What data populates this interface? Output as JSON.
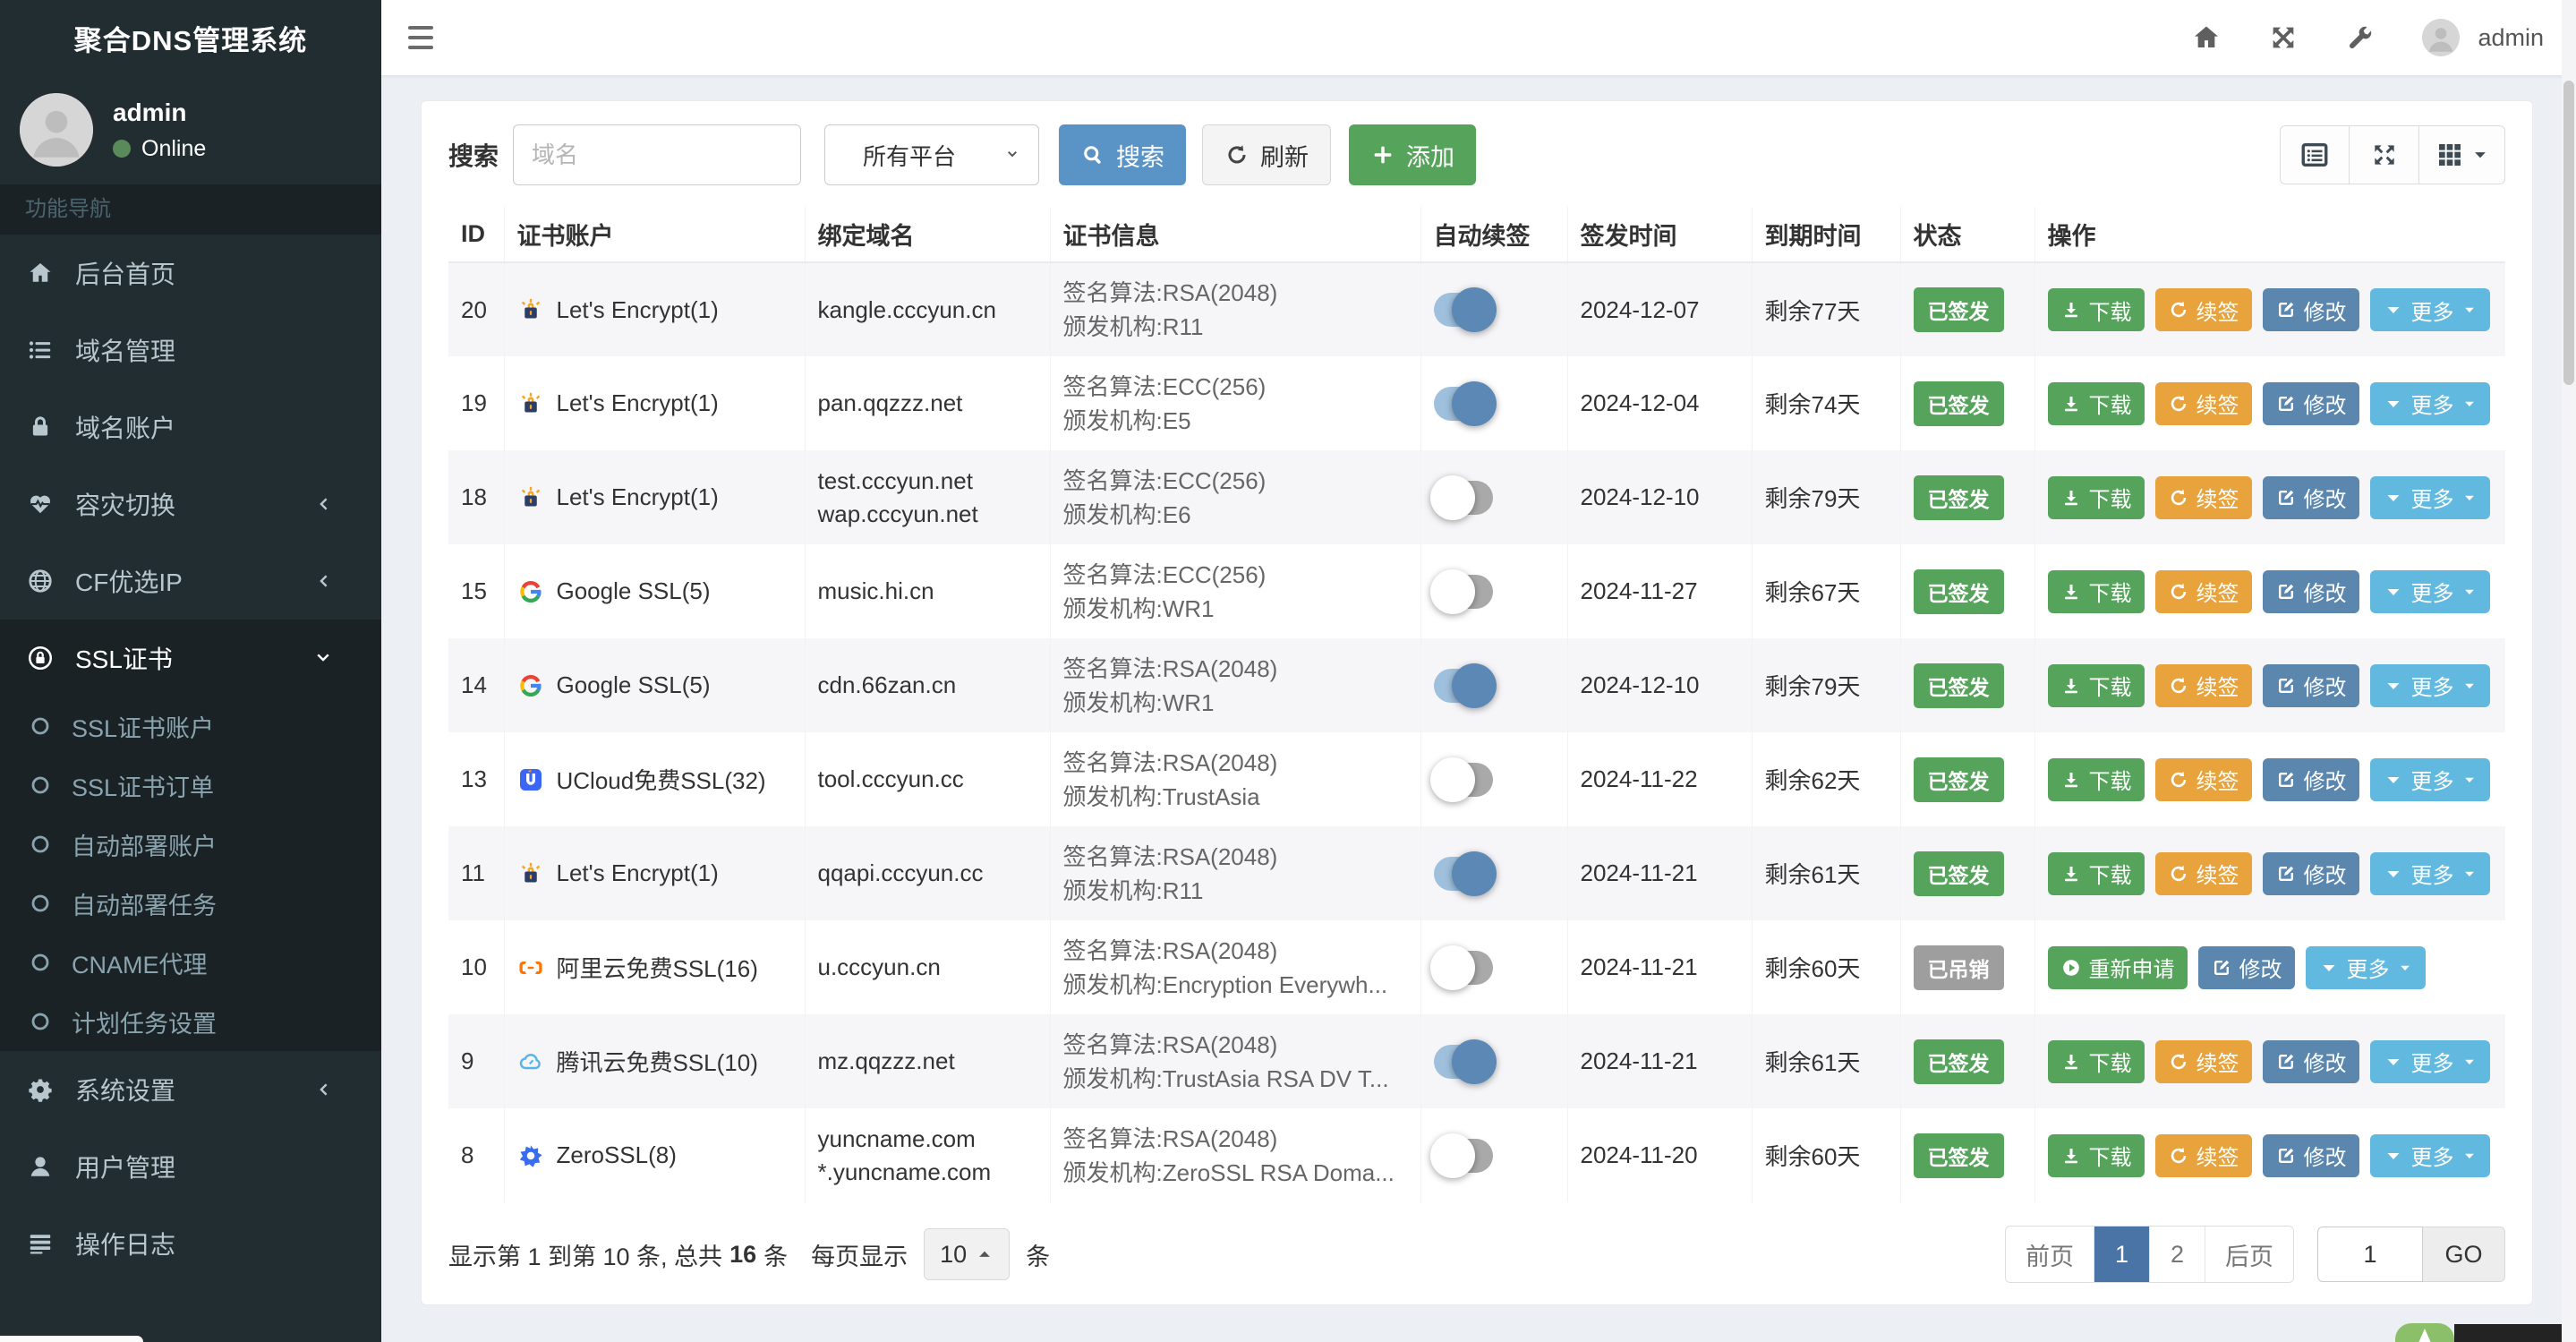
{
  "app": {
    "title": "聚合DNS管理系统"
  },
  "topbar": {
    "username": "admin",
    "icons": [
      "home-icon",
      "fullscreen-icon",
      "wrench-icon"
    ]
  },
  "sidebar": {
    "user": {
      "name": "admin",
      "status": "Online"
    },
    "nav_header": "功能导航",
    "items": [
      {
        "label": "后台首页",
        "icon": "home"
      },
      {
        "label": "域名管理",
        "icon": "list"
      },
      {
        "label": "域名账户",
        "icon": "lock"
      },
      {
        "label": "容灾切换",
        "icon": "heartbeat",
        "arrow": "left"
      },
      {
        "label": "CF优选IP",
        "icon": "globe",
        "arrow": "left"
      },
      {
        "label": "SSL证书",
        "icon": "ssl",
        "arrow": "down",
        "active": true,
        "children": [
          "SSL证书账户",
          "SSL证书订单",
          "自动部署账户",
          "自动部署任务",
          "CNAME代理",
          "计划任务设置"
        ]
      },
      {
        "label": "系统设置",
        "icon": "gears",
        "arrow": "left"
      },
      {
        "label": "用户管理",
        "icon": "user"
      },
      {
        "label": "操作日志",
        "icon": "loglist"
      }
    ]
  },
  "toolbar": {
    "search_label": "搜索",
    "input_placeholder": "域名",
    "platform_select": "所有平台",
    "search_btn": "搜索",
    "refresh_btn": "刷新",
    "add_btn": "添加",
    "view_buttons": [
      "table-view-icon",
      "fullscreen-view-icon",
      "columns-view-icon"
    ]
  },
  "table": {
    "columns": [
      "ID",
      "证书账户",
      "绑定域名",
      "证书信息",
      "自动续签",
      "签发时间",
      "到期时间",
      "状态",
      "操作"
    ],
    "action_defs": {
      "download": {
        "label": "下载",
        "style": "green",
        "icon": "download"
      },
      "renew": {
        "label": "续签",
        "style": "orange",
        "icon": "refresh"
      },
      "edit": {
        "label": "修改",
        "style": "steel",
        "icon": "edit"
      },
      "more": {
        "label": "更多",
        "style": "sky",
        "icon": "caret-down",
        "caret": true
      },
      "reapply": {
        "label": "重新申请",
        "style": "green",
        "icon": "play"
      }
    },
    "rows": [
      {
        "id": "20",
        "account": "Let's Encrypt(1)",
        "provider_icon": "letsencrypt",
        "domains": [
          "kangle.cccyun.cn"
        ],
        "info": [
          "签名算法:RSA(2048)",
          "颁发机构:R11"
        ],
        "auto_renew": true,
        "issued": "2024-12-07",
        "expiry": "剩余77天",
        "status": "已签发",
        "status_type": "success",
        "actions": [
          "download",
          "renew",
          "edit",
          "more"
        ]
      },
      {
        "id": "19",
        "account": "Let's Encrypt(1)",
        "provider_icon": "letsencrypt",
        "domains": [
          "pan.qqzzz.net"
        ],
        "info": [
          "签名算法:ECC(256)",
          "颁发机构:E5"
        ],
        "auto_renew": true,
        "issued": "2024-12-04",
        "expiry": "剩余74天",
        "status": "已签发",
        "status_type": "success",
        "actions": [
          "download",
          "renew",
          "edit",
          "more"
        ]
      },
      {
        "id": "18",
        "account": "Let's Encrypt(1)",
        "provider_icon": "letsencrypt",
        "domains": [
          "test.cccyun.net",
          "wap.cccyun.net"
        ],
        "info": [
          "签名算法:ECC(256)",
          "颁发机构:E6"
        ],
        "auto_renew": false,
        "issued": "2024-12-10",
        "expiry": "剩余79天",
        "status": "已签发",
        "status_type": "success",
        "actions": [
          "download",
          "renew",
          "edit",
          "more"
        ]
      },
      {
        "id": "15",
        "account": "Google SSL(5)",
        "provider_icon": "google",
        "domains": [
          "music.hi.cn"
        ],
        "info": [
          "签名算法:ECC(256)",
          "颁发机构:WR1"
        ],
        "auto_renew": false,
        "issued": "2024-11-27",
        "expiry": "剩余67天",
        "status": "已签发",
        "status_type": "success",
        "actions": [
          "download",
          "renew",
          "edit",
          "more"
        ]
      },
      {
        "id": "14",
        "account": "Google SSL(5)",
        "provider_icon": "google",
        "domains": [
          "cdn.66zan.cn"
        ],
        "info": [
          "签名算法:RSA(2048)",
          "颁发机构:WR1"
        ],
        "auto_renew": true,
        "issued": "2024-12-10",
        "expiry": "剩余79天",
        "status": "已签发",
        "status_type": "success",
        "actions": [
          "download",
          "renew",
          "edit",
          "more"
        ]
      },
      {
        "id": "13",
        "account": "UCloud免费SSL(32)",
        "provider_icon": "ucloud",
        "domains": [
          "tool.cccyun.cc"
        ],
        "info": [
          "签名算法:RSA(2048)",
          "颁发机构:TrustAsia"
        ],
        "auto_renew": false,
        "issued": "2024-11-22",
        "expiry": "剩余62天",
        "status": "已签发",
        "status_type": "success",
        "actions": [
          "download",
          "renew",
          "edit",
          "more"
        ]
      },
      {
        "id": "11",
        "account": "Let's Encrypt(1)",
        "provider_icon": "letsencrypt",
        "domains": [
          "qqapi.cccyun.cc"
        ],
        "info": [
          "签名算法:RSA(2048)",
          "颁发机构:R11"
        ],
        "auto_renew": true,
        "issued": "2024-11-21",
        "expiry": "剩余61天",
        "status": "已签发",
        "status_type": "success",
        "actions": [
          "download",
          "renew",
          "edit",
          "more"
        ]
      },
      {
        "id": "10",
        "account": "阿里云免费SSL(16)",
        "provider_icon": "aliyun",
        "domains": [
          "u.cccyun.cn"
        ],
        "info": [
          "签名算法:RSA(2048)",
          "颁发机构:Encryption Everywh..."
        ],
        "auto_renew": false,
        "issued": "2024-11-21",
        "expiry": "剩余60天",
        "status": "已吊销",
        "status_type": "revoked",
        "actions": [
          "reapply",
          "edit",
          "more"
        ]
      },
      {
        "id": "9",
        "account": "腾讯云免费SSL(10)",
        "provider_icon": "tencent",
        "domains": [
          "mz.qqzzz.net"
        ],
        "info": [
          "签名算法:RSA(2048)",
          "颁发机构:TrustAsia RSA DV T..."
        ],
        "auto_renew": true,
        "issued": "2024-11-21",
        "expiry": "剩余61天",
        "status": "已签发",
        "status_type": "success",
        "actions": [
          "download",
          "renew",
          "edit",
          "more"
        ]
      },
      {
        "id": "8",
        "account": "ZeroSSL(8)",
        "provider_icon": "zerossl",
        "domains": [
          "yuncname.com",
          "*.yuncname.com"
        ],
        "info": [
          "签名算法:RSA(2048)",
          "颁发机构:ZeroSSL RSA Doma..."
        ],
        "auto_renew": false,
        "issued": "2024-11-20",
        "expiry": "剩余60天",
        "status": "已签发",
        "status_type": "success",
        "actions": [
          "download",
          "renew",
          "edit",
          "more"
        ]
      }
    ]
  },
  "footer": {
    "info_prefix": "显示第 1 到第 10 条, 总共",
    "total": "16",
    "info_suffix": "条",
    "per_page_label": "每页显示",
    "per_page": "10",
    "unit": "条",
    "pages": [
      {
        "label": "前页"
      },
      {
        "label": "1",
        "active": true
      },
      {
        "label": "2"
      },
      {
        "label": "后页"
      }
    ],
    "jump_value": "1",
    "go_label": "GO"
  },
  "colors": {
    "sidebar_bg": "#222d32",
    "sidebar_active_bg": "#1a2226",
    "primary": "#5a93c6",
    "success": "#56a45c",
    "warning": "#e9a33d",
    "steel": "#5b87ae",
    "info": "#62b9e0",
    "revoked": "#9e9e9e",
    "expiry_green": "#3f9e45",
    "page_active": "#4a74a6",
    "toggle_on": "#5c88b6",
    "toggle_off": "#a9a9a9",
    "online_dot": "#5a8a5a"
  }
}
